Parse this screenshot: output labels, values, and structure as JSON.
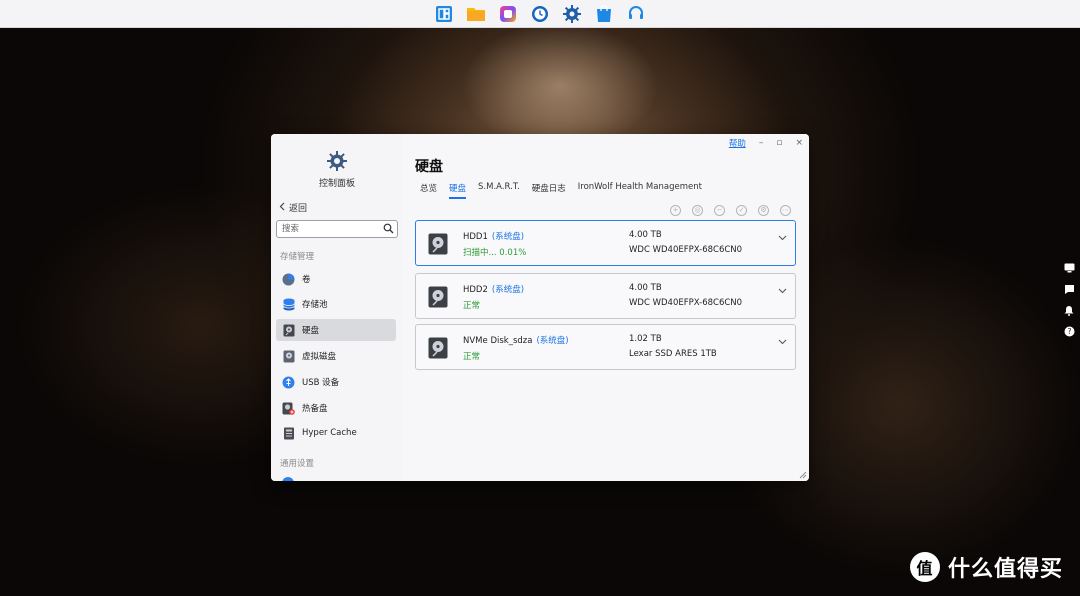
{
  "dock": {
    "icons": [
      "layout-icon",
      "folder-icon",
      "app-center-icon",
      "clock-icon",
      "settings-icon",
      "store-icon",
      "support-icon"
    ]
  },
  "window": {
    "help_label": "帮助",
    "minimize": "–",
    "maximize": "▫",
    "close": "×"
  },
  "sidebar": {
    "app_title": "控制面板",
    "back_label": "返回",
    "search_placeholder": "搜索",
    "section_storage": "存储管理",
    "section_general": "通用设置",
    "items": [
      {
        "label": "卷",
        "icon": "volume-icon"
      },
      {
        "label": "存储池",
        "icon": "storage-pool-icon"
      },
      {
        "label": "硬盘",
        "icon": "disk-icon"
      },
      {
        "label": "虚拟磁盘",
        "icon": "virtual-disk-icon"
      },
      {
        "label": "USB 设备",
        "icon": "usb-icon"
      },
      {
        "label": "热备盘",
        "icon": "hot-spare-icon"
      },
      {
        "label": "Hyper Cache",
        "icon": "cache-icon"
      }
    ]
  },
  "main": {
    "title": "硬盘",
    "tabs": [
      "总览",
      "硬盘",
      "S.M.A.R.T.",
      "硬盘日志",
      "IronWolf Health Management"
    ],
    "active_tab": "硬盘",
    "disks": [
      {
        "name": "HDD1",
        "tag": "(系统盘)",
        "status": "扫描中... 0.01%",
        "size": "4.00 TB",
        "model": "WDC WD40EFPX-68C6CN0"
      },
      {
        "name": "HDD2",
        "tag": "(系统盘)",
        "status": "正常",
        "size": "4.00 TB",
        "model": "WDC WD40EFPX-68C6CN0"
      },
      {
        "name": "NVMe Disk_sdza",
        "tag": "(系统盘)",
        "status": "正常",
        "size": "1.02 TB",
        "model": "Lexar SSD ARES 1TB"
      }
    ]
  },
  "watermark": {
    "text": "什么值得买",
    "logo": "值"
  },
  "colors": {
    "accent": "#1a73e8",
    "status_ok": "#2e9b38",
    "selected_border": "#2b7de9"
  }
}
